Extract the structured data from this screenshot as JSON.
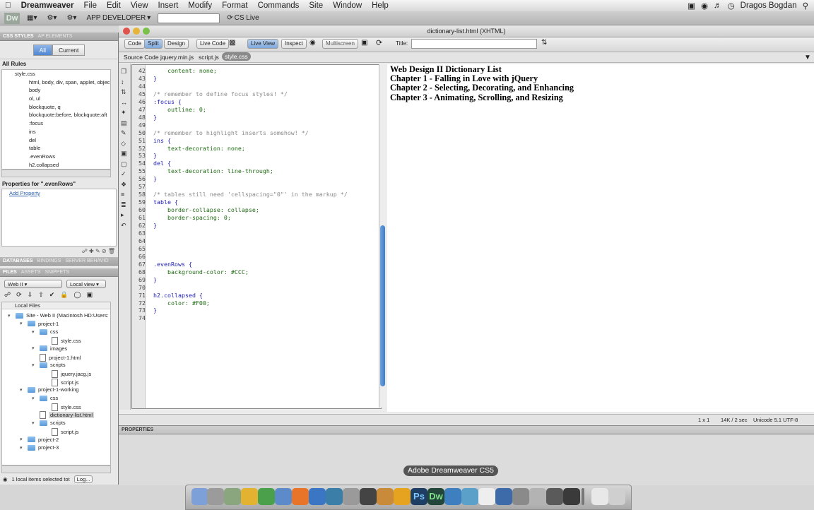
{
  "menubar": {
    "app": "Dreamweaver",
    "items": [
      "File",
      "Edit",
      "View",
      "Insert",
      "Modify",
      "Format",
      "Commands",
      "Site",
      "Window",
      "Help"
    ],
    "user": "Dragos Bogdan"
  },
  "appbar": {
    "logo": "Dw",
    "workspace": "APP DEVELOPER",
    "cslive": "CS Live"
  },
  "css_panel": {
    "tab_active": "CSS STYLES",
    "tab_other": "AP ELEMENTS",
    "all": "All",
    "current": "Current",
    "all_rules": "All Rules",
    "file": "style.css",
    "rules": [
      "html, body, div, span, applet, objec",
      "body",
      "ol, ul",
      "blockquote, q",
      "blockquote:before, blockquote:aft",
      ":focus",
      "ins",
      "del",
      "table",
      ".evenRows",
      "h2.collapsed"
    ],
    "properties_for": "Properties for \".evenRows\"",
    "add_property": "Add Property"
  },
  "db_panel": {
    "tabs": [
      "DATABASES",
      "BINDINGS",
      "SERVER BEHAVIO"
    ]
  },
  "files_panel": {
    "tabs": [
      "FILES",
      "ASSETS",
      "SNIPPETS"
    ],
    "site": "Web II",
    "view": "Local view",
    "local_files": "Local Files",
    "tree": [
      {
        "label": "Site - Web II (Macintosh HD:Users:",
        "type": "folder",
        "level": 0
      },
      {
        "label": "project-1",
        "type": "folder",
        "level": 1
      },
      {
        "label": "css",
        "type": "folder",
        "level": 2
      },
      {
        "label": "style.css",
        "type": "file",
        "level": 3
      },
      {
        "label": "images",
        "type": "folder",
        "level": 2
      },
      {
        "label": "project-1.html",
        "type": "file",
        "level": 2
      },
      {
        "label": "scripts",
        "type": "folder",
        "level": 2
      },
      {
        "label": "jquery.jacg.js",
        "type": "file",
        "level": 3
      },
      {
        "label": "script.js",
        "type": "file",
        "level": 3
      },
      {
        "label": "project-1-working",
        "type": "folder",
        "level": 1
      },
      {
        "label": "css",
        "type": "folder",
        "level": 2
      },
      {
        "label": "style.css",
        "type": "file",
        "level": 3
      },
      {
        "label": "dictionary-list.html",
        "type": "file",
        "level": 2,
        "selected": true
      },
      {
        "label": "scripts",
        "type": "folder",
        "level": 2
      },
      {
        "label": "script.js",
        "type": "file",
        "level": 3
      },
      {
        "label": "project-2",
        "type": "folder",
        "level": 1
      },
      {
        "label": "project-3",
        "type": "folder",
        "level": 1
      }
    ],
    "status": "1 local items selected tot",
    "log": "Log..."
  },
  "document": {
    "title": "dictionary-list.html (XHTML)",
    "toolbar": {
      "code": "Code",
      "split": "Split",
      "design": "Design",
      "live_code": "Live Code",
      "live_view": "Live View",
      "inspect": "Inspect",
      "multiscreen": "Multiscreen",
      "title_label": "Title:"
    },
    "related_files": [
      "Source Code",
      "jquery.min.js",
      "script.js",
      "style.css"
    ],
    "code_lines": [
      {
        "n": "42",
        "t": "    content: none;",
        "c": "pr"
      },
      {
        "n": "43",
        "t": "}",
        "c": "kw"
      },
      {
        "n": "44",
        "t": "",
        "c": ""
      },
      {
        "n": "45",
        "t": "/* remember to define focus styles! */",
        "c": "cm"
      },
      {
        "n": "46",
        "t": ":focus {",
        "c": "kw"
      },
      {
        "n": "47",
        "t": "    outline: 0;",
        "c": "pr"
      },
      {
        "n": "48",
        "t": "}",
        "c": "kw"
      },
      {
        "n": "49",
        "t": "",
        "c": ""
      },
      {
        "n": "50",
        "t": "/* remember to highlight inserts somehow! */",
        "c": "cm"
      },
      {
        "n": "51",
        "t": "ins {",
        "c": "kw"
      },
      {
        "n": "52",
        "t": "    text-decoration: none;",
        "c": "pr"
      },
      {
        "n": "53",
        "t": "}",
        "c": "kw"
      },
      {
        "n": "54",
        "t": "del {",
        "c": "kw"
      },
      {
        "n": "55",
        "t": "    text-decoration: line-through;",
        "c": "pr"
      },
      {
        "n": "56",
        "t": "}",
        "c": "kw"
      },
      {
        "n": "57",
        "t": "",
        "c": ""
      },
      {
        "n": "58",
        "t": "/* tables still need 'cellspacing=\"0\"' in the markup */",
        "c": "cm"
      },
      {
        "n": "59",
        "t": "table {",
        "c": "kw"
      },
      {
        "n": "60",
        "t": "    border-collapse: collapse;",
        "c": "pr"
      },
      {
        "n": "61",
        "t": "    border-spacing: 0;",
        "c": "pr"
      },
      {
        "n": "62",
        "t": "}",
        "c": "kw"
      },
      {
        "n": "63",
        "t": "",
        "c": ""
      },
      {
        "n": "64",
        "t": "",
        "c": ""
      },
      {
        "n": "65",
        "t": "",
        "c": ""
      },
      {
        "n": "66",
        "t": "",
        "c": ""
      },
      {
        "n": "67",
        "t": ".evenRows {",
        "c": "kw"
      },
      {
        "n": "68",
        "t": "    background-color: #CCC;",
        "c": "pr"
      },
      {
        "n": "69",
        "t": "}",
        "c": "kw"
      },
      {
        "n": "70",
        "t": "",
        "c": ""
      },
      {
        "n": "71",
        "t": "h2.collapsed {",
        "c": "kw"
      },
      {
        "n": "72",
        "t": "    color: #F00;",
        "c": "pr"
      },
      {
        "n": "73",
        "t": "}",
        "c": "kw"
      },
      {
        "n": "74",
        "t": "",
        "c": ""
      }
    ],
    "design_lines": [
      "Web Design II Dictionary List",
      "Chapter 1 - Falling in Love with jQuery",
      "Chapter 2 - Selecting, Decorating, and Enhancing",
      "Chapter 3 - Animating, Scrolling, and Resizing"
    ],
    "status": {
      "size": "1 x 1",
      "download": "14K / 2 sec",
      "encoding": "Unicode 5.1 UTF-8"
    }
  },
  "properties_panel": {
    "title": "PROPERTIES"
  },
  "dock": {
    "tooltip": "Adobe Dreamweaver CS5"
  },
  "colors": {
    "accent": "#4e86d3",
    "code_keyword": "#1b1bb5",
    "code_comment": "#8a8a8a",
    "code_property": "#1c6a10"
  }
}
